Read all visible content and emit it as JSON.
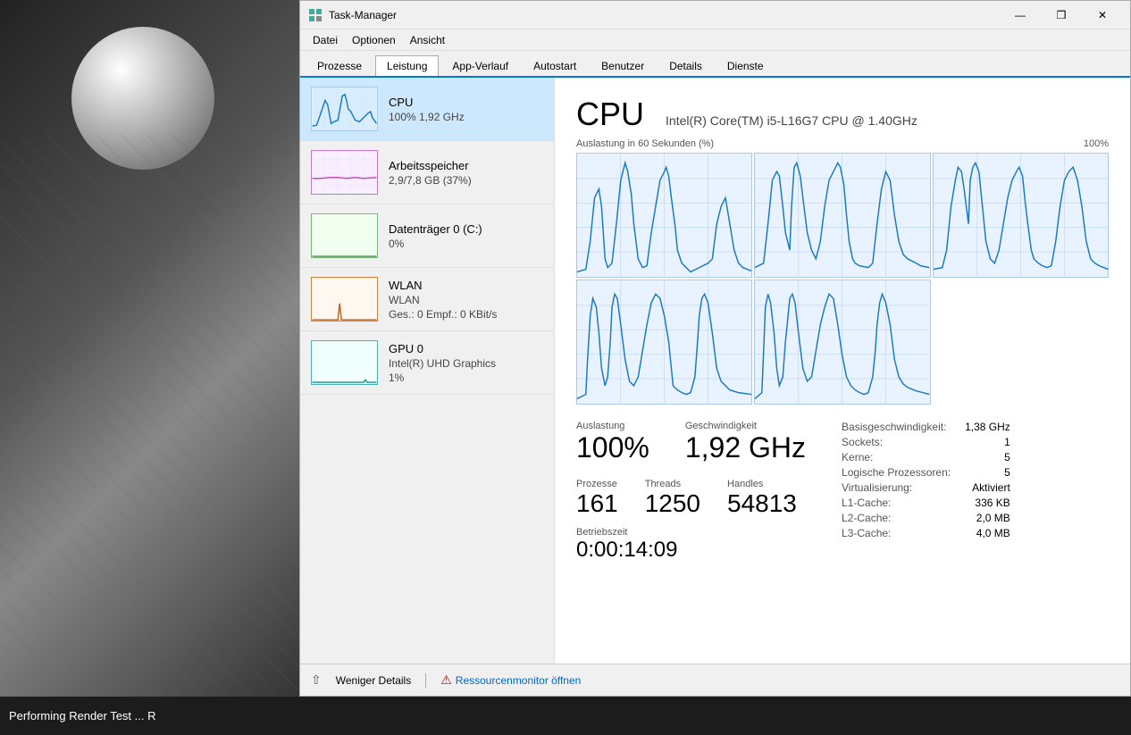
{
  "window": {
    "title": "Task-Manager",
    "icon": "task-manager-icon"
  },
  "menu": {
    "items": [
      "Datei",
      "Optionen",
      "Ansicht"
    ]
  },
  "tabs": {
    "items": [
      "Prozesse",
      "Leistung",
      "App-Verlauf",
      "Autostart",
      "Benutzer",
      "Details",
      "Dienste"
    ],
    "active": "Leistung"
  },
  "sidebar": {
    "items": [
      {
        "name": "CPU",
        "value": "100% 1,92 GHz",
        "active": true
      },
      {
        "name": "Arbeitsspeicher",
        "value": "2,9/7,8 GB (37%)",
        "active": false
      },
      {
        "name": "Datenträger 0 (C:)",
        "value": "0%",
        "active": false
      },
      {
        "name": "WLAN",
        "value_line1": "WLAN",
        "value": "Ges.: 0 Empf.: 0 KBit/s",
        "active": false
      },
      {
        "name": "GPU 0",
        "value_line1": "Intel(R) UHD Graphics",
        "value": "1%",
        "active": false
      }
    ]
  },
  "cpu_panel": {
    "title": "CPU",
    "model": "Intel(R) Core(TM) i5-L16G7 CPU @ 1.40GHz",
    "chart_label": "Auslastung in 60 Sekunden (%)",
    "chart_max": "100%",
    "auslastung_label": "Auslastung",
    "auslastung_value": "100%",
    "geschwindigkeit_label": "Geschwindigkeit",
    "geschwindigkeit_value": "1,92 GHz",
    "prozesse_label": "Prozesse",
    "prozesse_value": "161",
    "threads_label": "Threads",
    "threads_value": "1250",
    "handles_label": "Handles",
    "handles_value": "54813",
    "betriebszeit_label": "Betriebszeit",
    "betriebszeit_value": "0:00:14:09",
    "info": {
      "basisgeschwindigkeit_label": "Basisgeschwindigkeit:",
      "basisgeschwindigkeit_value": "1,38 GHz",
      "sockets_label": "Sockets:",
      "sockets_value": "1",
      "kerne_label": "Kerne:",
      "kerne_value": "5",
      "logische_label": "Logische Prozessoren:",
      "logische_value": "5",
      "virtualisierung_label": "Virtualisierung:",
      "virtualisierung_value": "Aktiviert",
      "l1_label": "L1-Cache:",
      "l1_value": "336 KB",
      "l2_label": "L2-Cache:",
      "l2_value": "2,0 MB",
      "l3_label": "L3-Cache:",
      "l3_value": "4,0 MB"
    }
  },
  "bottom_bar": {
    "less_details": "Weniger Details",
    "resource_monitor": "Ressourcenmonitor öffnen"
  },
  "taskbar": {
    "text": "Performing Render Test ... R"
  }
}
